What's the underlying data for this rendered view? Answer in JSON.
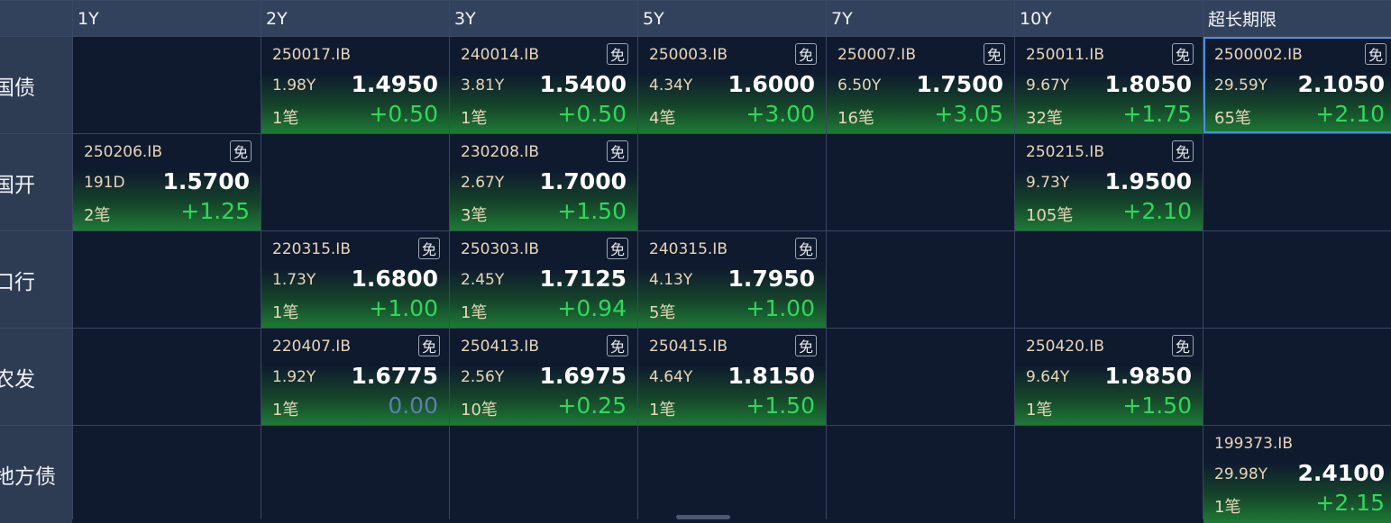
{
  "columns": [
    "1Y",
    "2Y",
    "3Y",
    "5Y",
    "7Y",
    "10Y",
    "超长期限"
  ],
  "rows": [
    {
      "label": "国债",
      "cells": [
        null,
        {
          "code": "250017.IB",
          "mian": null,
          "term": "1.98Y",
          "yield": "1.4950",
          "count": "1笔",
          "change": "+0.50"
        },
        {
          "code": "240014.IB",
          "mian": "免",
          "term": "3.81Y",
          "yield": "1.5400",
          "count": "1笔",
          "change": "+0.50"
        },
        {
          "code": "250003.IB",
          "mian": "免",
          "term": "4.34Y",
          "yield": "1.6000",
          "count": "4笔",
          "change": "+3.00"
        },
        {
          "code": "250007.IB",
          "mian": "免",
          "term": "6.50Y",
          "yield": "1.7500",
          "count": "16笔",
          "change": "+3.05"
        },
        {
          "code": "250011.IB",
          "mian": "免",
          "term": "9.67Y",
          "yield": "1.8050",
          "count": "32笔",
          "change": "+1.75"
        },
        {
          "code": "2500002.IB",
          "mian": "免",
          "term": "29.59Y",
          "yield": "2.1050",
          "count": "65笔",
          "change": "+2.10",
          "selected": true
        }
      ]
    },
    {
      "label": "国开",
      "cells": [
        {
          "code": "250206.IB",
          "mian": "免",
          "term": "191D",
          "yield": "1.5700",
          "count": "2笔",
          "change": "+1.25"
        },
        null,
        {
          "code": "230208.IB",
          "mian": "免",
          "term": "2.67Y",
          "yield": "1.7000",
          "count": "3笔",
          "change": "+1.50"
        },
        null,
        null,
        {
          "code": "250215.IB",
          "mian": "免",
          "term": "9.73Y",
          "yield": "1.9500",
          "count": "105笔",
          "change": "+2.10"
        },
        null
      ]
    },
    {
      "label": "口行",
      "cells": [
        null,
        {
          "code": "220315.IB",
          "mian": "免",
          "term": "1.73Y",
          "yield": "1.6800",
          "count": "1笔",
          "change": "+1.00"
        },
        {
          "code": "250303.IB",
          "mian": "免",
          "term": "2.45Y",
          "yield": "1.7125",
          "count": "1笔",
          "change": "+0.94"
        },
        {
          "code": "240315.IB",
          "mian": "免",
          "term": "4.13Y",
          "yield": "1.7950",
          "count": "5笔",
          "change": "+1.00"
        },
        null,
        null,
        null
      ]
    },
    {
      "label": "农发",
      "cells": [
        null,
        {
          "code": "220407.IB",
          "mian": "免",
          "term": "1.92Y",
          "yield": "1.6775",
          "count": "1笔",
          "change": "0.00",
          "flat": true
        },
        {
          "code": "250413.IB",
          "mian": "免",
          "term": "2.56Y",
          "yield": "1.6975",
          "count": "10笔",
          "change": "+0.25"
        },
        {
          "code": "250415.IB",
          "mian": "免",
          "term": "4.64Y",
          "yield": "1.8150",
          "count": "1笔",
          "change": "+1.50"
        },
        null,
        {
          "code": "250420.IB",
          "mian": "免",
          "term": "9.64Y",
          "yield": "1.9850",
          "count": "1笔",
          "change": "+1.50"
        },
        null
      ]
    },
    {
      "label": "地方债",
      "cells": [
        null,
        null,
        null,
        null,
        null,
        null,
        {
          "code": "199373.IB",
          "mian": null,
          "term": "29.98Y",
          "yield": "2.4100",
          "count": "1笔",
          "change": "+2.15"
        }
      ]
    }
  ],
  "colors": {
    "background": "#0f1a2e",
    "header": "#33425c",
    "positive": "#2fd85a",
    "flat": "#5c7eae",
    "selected_border": "#4a90e2"
  }
}
